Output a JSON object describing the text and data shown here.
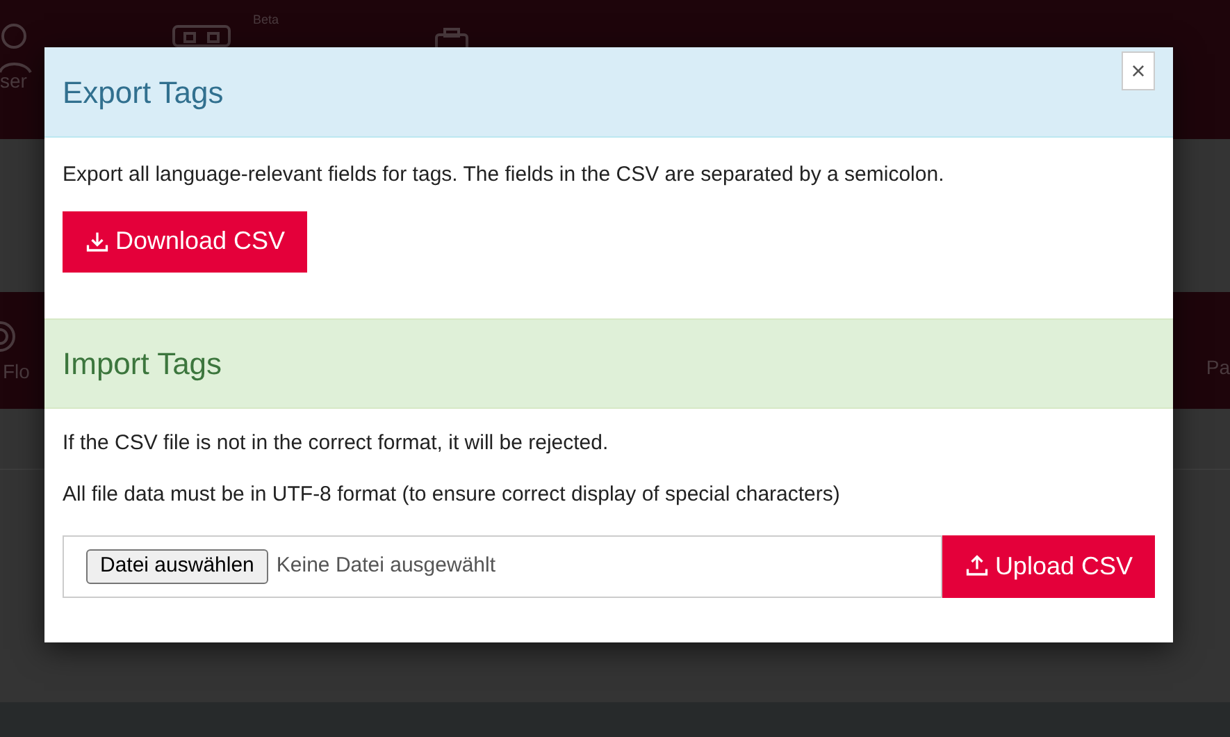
{
  "background": {
    "nav_labels": [
      "ser",
      "Beta"
    ],
    "band_labels": [
      "Flo",
      "Pa"
    ]
  },
  "modal": {
    "close": "×",
    "export": {
      "title": "Export Tags",
      "text": "Export all language-relevant fields for tags. The fields in the CSV are separated by a semicolon.",
      "button": "Download CSV"
    },
    "import": {
      "title": "Import Tags",
      "notes": [
        "If the CSV file is not in the correct format, it will be rejected.",
        "All file data must be in UTF-8 format (to ensure correct display of special characters)"
      ],
      "file_button": "Datei auswählen",
      "file_status": "Keine Datei ausgewählt",
      "button": "Upload CSV"
    }
  }
}
